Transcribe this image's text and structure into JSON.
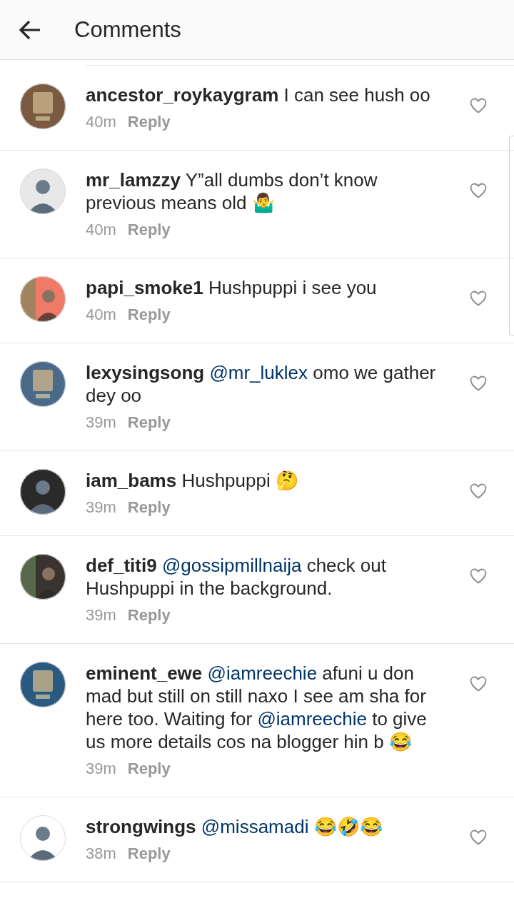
{
  "header": {
    "title": "Comments"
  },
  "comments": [
    {
      "avatar": {
        "kind": "picture"
      },
      "username": "ancestor_roykaygram",
      "parts": [
        {
          "kind": "text",
          "text": "I can see hush oo"
        }
      ],
      "time": "40m",
      "reply": "Reply"
    },
    {
      "avatar": {
        "kind": "picture"
      },
      "username": "mr_lamzzy",
      "parts": [
        {
          "kind": "text",
          "text": "Y”all dumbs don’t know previous means old 🤷‍♂️"
        }
      ],
      "time": "40m",
      "reply": "Reply"
    },
    {
      "avatar": {
        "kind": "picture"
      },
      "username": "papi_smoke1",
      "parts": [
        {
          "kind": "text",
          "text": "Hushpuppi i see you"
        }
      ],
      "time": "40m",
      "reply": "Reply"
    },
    {
      "avatar": {
        "kind": "picture"
      },
      "username": "lexysingsong",
      "parts": [
        {
          "kind": "mention",
          "text": "@mr_luklex"
        },
        {
          "kind": "text",
          "text": " omo we gather dey oo"
        }
      ],
      "time": "39m",
      "reply": "Reply"
    },
    {
      "avatar": {
        "kind": "picture"
      },
      "username": "iam_bams",
      "parts": [
        {
          "kind": "text",
          "text": "Hushpuppi 🤔"
        }
      ],
      "time": "39m",
      "reply": "Reply"
    },
    {
      "avatar": {
        "kind": "picture"
      },
      "username": "def_titi9",
      "parts": [
        {
          "kind": "mention",
          "text": "@gossipmillnaija"
        },
        {
          "kind": "text",
          "text": " check out Hushpuppi in the background."
        }
      ],
      "time": "39m",
      "reply": "Reply"
    },
    {
      "avatar": {
        "kind": "picture"
      },
      "username": "eminent_ewe",
      "parts": [
        {
          "kind": "mention",
          "text": "@iamreechie"
        },
        {
          "kind": "text",
          "text": " afuni u don mad but still on still naxo I see am sha for here too. Waiting for "
        },
        {
          "kind": "mention",
          "text": "@iamreechie"
        },
        {
          "kind": "text",
          "text": " to give us more details cos na blogger hin b 😂"
        }
      ],
      "time": "39m",
      "reply": "Reply"
    },
    {
      "avatar": {
        "kind": "picture"
      },
      "username": "strongwings",
      "parts": [
        {
          "kind": "mention",
          "text": "@missamadi"
        },
        {
          "kind": "text",
          "text": " 😂🤣😂"
        }
      ],
      "time": "38m",
      "reply": "Reply"
    }
  ]
}
